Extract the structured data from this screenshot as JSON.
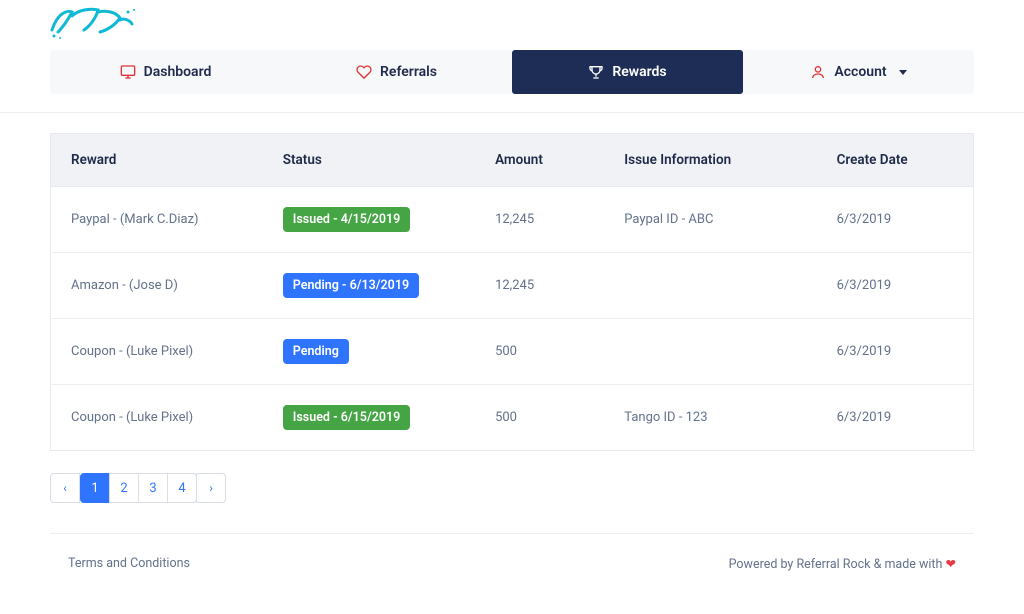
{
  "logo_alt": "Fake",
  "nav": {
    "dashboard": "Dashboard",
    "referrals": "Referrals",
    "rewards": "Rewards",
    "account": "Account"
  },
  "table": {
    "headers": {
      "reward": "Reward",
      "status": "Status",
      "amount": "Amount",
      "issue": "Issue Information",
      "create": "Create Date"
    },
    "rows": [
      {
        "reward": "Paypal - (Mark C.Diaz)",
        "status": "Issued - 4/15/2019",
        "status_color": "green",
        "amount": "12,245",
        "issue": "Paypal ID - ABC",
        "create": "6/3/2019"
      },
      {
        "reward": "Amazon - (Jose D)",
        "status": "Pending - 6/13/2019",
        "status_color": "blue",
        "amount": "12,245",
        "issue": "",
        "create": "6/3/2019"
      },
      {
        "reward": "Coupon - (Luke Pixel)",
        "status": "Pending",
        "status_color": "blue",
        "amount": "500",
        "issue": "",
        "create": "6/3/2019"
      },
      {
        "reward": "Coupon - (Luke Pixel)",
        "status": "Issued - 6/15/2019",
        "status_color": "green",
        "amount": "500",
        "issue": "Tango ID - 123",
        "create": "6/3/2019"
      }
    ]
  },
  "pagination": {
    "prev": "‹",
    "pages": [
      "1",
      "2",
      "3",
      "4"
    ],
    "active": "1",
    "next": "›"
  },
  "footer": {
    "terms": "Terms and Conditions",
    "powered": "Powered by Referral Rock & made with ",
    "heart": "❤"
  }
}
